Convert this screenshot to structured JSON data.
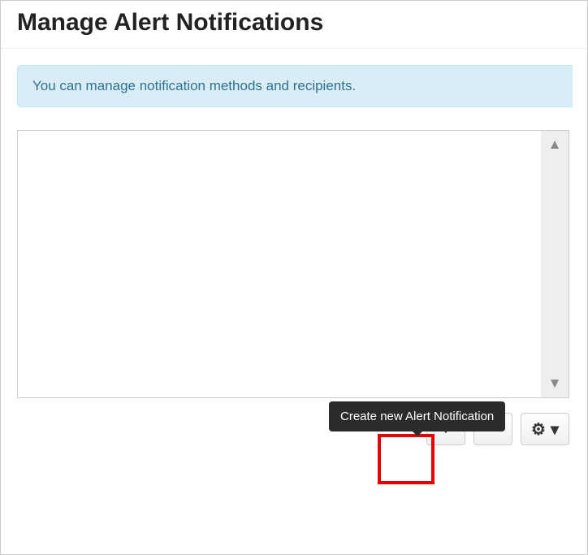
{
  "header": {
    "title": "Manage Alert Notifications"
  },
  "info": {
    "text": "You can manage notification methods and recipients."
  },
  "tooltip": {
    "add": "Create new Alert Notification"
  },
  "icons": {
    "plus": "+",
    "minus": "−",
    "gear": "⚙",
    "caret": "▾",
    "up": "▲",
    "down": "▼"
  }
}
